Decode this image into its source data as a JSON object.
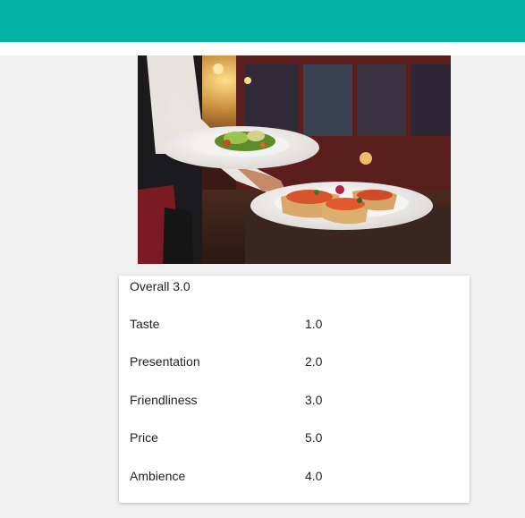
{
  "header": {
    "color": "#00b3a4"
  },
  "hero_image": {
    "alt": "Waiter carrying a salad plate and a bruschetta plate in a restaurant"
  },
  "rating": {
    "overall_label": "Overall 3.0",
    "items": [
      {
        "label": "Taste",
        "value": "1.0"
      },
      {
        "label": "Presentation",
        "value": "2.0"
      },
      {
        "label": "Friendliness",
        "value": "3.0"
      },
      {
        "label": "Price",
        "value": "5.0"
      },
      {
        "label": "Ambience",
        "value": "4.0"
      }
    ]
  }
}
